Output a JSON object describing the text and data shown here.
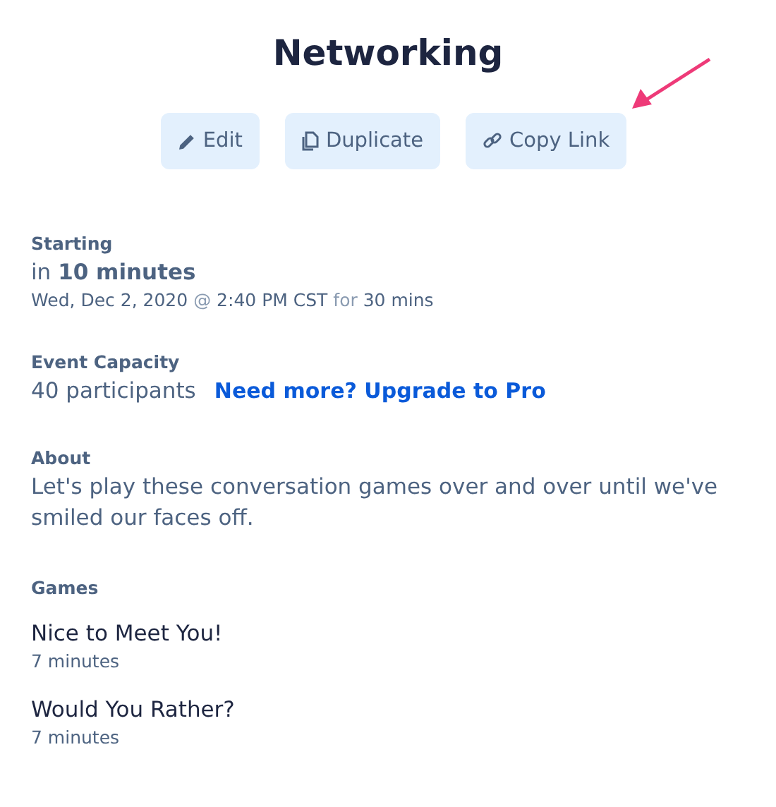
{
  "title": "Networking",
  "actions": [
    {
      "kind": "edit",
      "label": "Edit"
    },
    {
      "kind": "duplicate",
      "label": "Duplicate"
    },
    {
      "kind": "link",
      "label": "Copy Link"
    }
  ],
  "annotation": {
    "kind": "arrow"
  },
  "starting": {
    "label": "Starting",
    "prefix": "in",
    "relative": "10 minutes",
    "schedule": [
      {
        "text": "Wed, Dec 2, 2020",
        "muted": false
      },
      {
        "text": "@",
        "muted": true
      },
      {
        "text": "2:40 PM CST",
        "muted": false
      },
      {
        "text": "for",
        "muted": true
      },
      {
        "text": "30 mins",
        "muted": false
      }
    ]
  },
  "capacity": {
    "label": "Event Capacity",
    "value": "40 participants",
    "upgrade_link": "Need more? Upgrade to Pro"
  },
  "about": {
    "label": "About",
    "text": "Let's play these conversation games over and over until we've smiled our faces off."
  },
  "games": {
    "label": "Games",
    "items": [
      {
        "name": "Nice to Meet You!",
        "duration": "7 minutes"
      },
      {
        "name": "Would You Rather?",
        "duration": "7 minutes"
      }
    ]
  }
}
